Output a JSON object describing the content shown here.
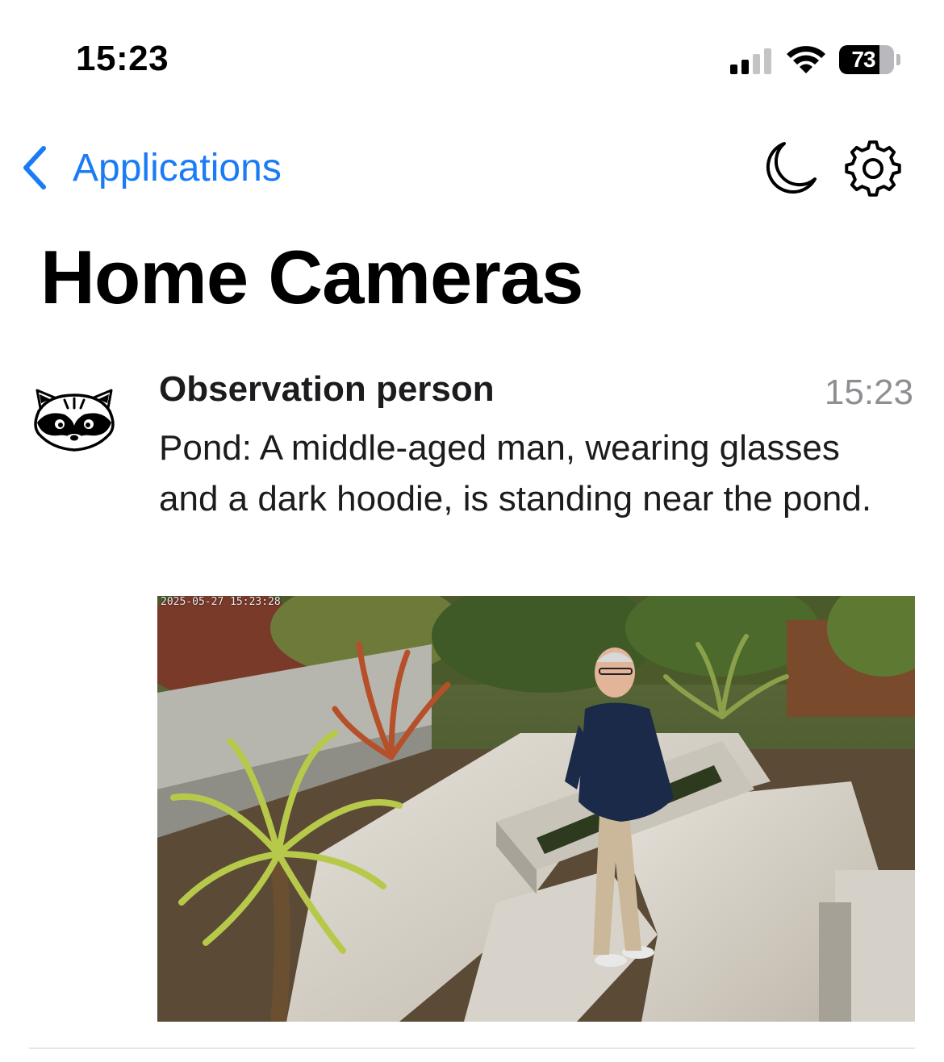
{
  "status_bar": {
    "time": "15:23",
    "battery_level": "73",
    "battery_fraction": 0.73,
    "signal_bars_active": 2,
    "signal_bars_total": 4
  },
  "nav": {
    "back_label": "Applications",
    "accent_color": "#1a7cf5"
  },
  "page": {
    "title": "Home Cameras"
  },
  "notification": {
    "title": "Observation person",
    "time": "15:23",
    "body": "Pond: A middle-aged man, wearing glasses and a dark hoodie, is standing near the pond.",
    "snapshot_timestamp": "2025-05-27 15:23:28",
    "icon": "raccoon-icon"
  },
  "icons": {
    "back": "chevron-left-icon",
    "do_not_disturb": "moon-icon",
    "settings": "gear-icon"
  }
}
